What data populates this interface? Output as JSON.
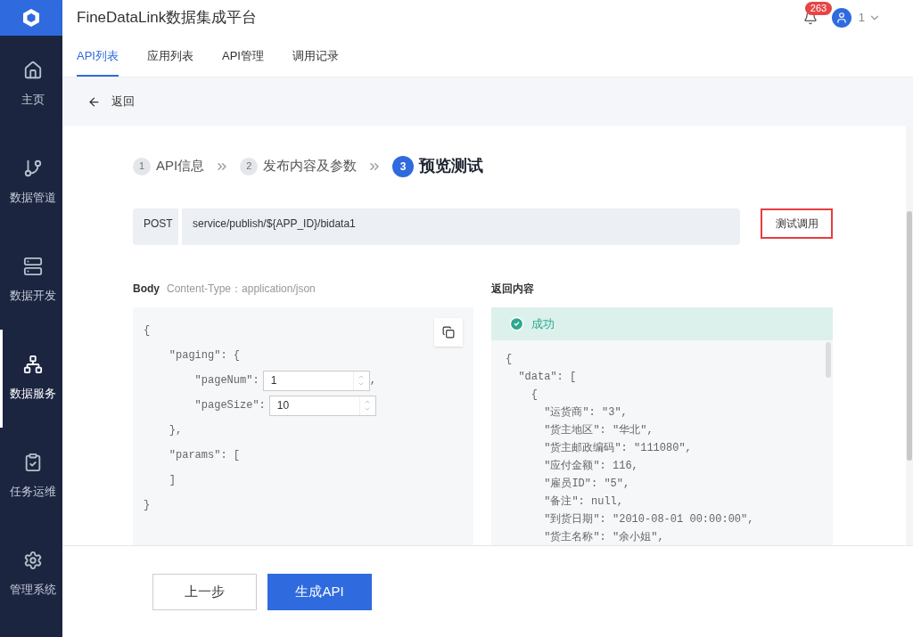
{
  "app": {
    "title": "FineDataLink数据集成平台",
    "notifications": "263",
    "user": "1"
  },
  "sidebar": {
    "items": [
      {
        "label": "主页",
        "selected": false
      },
      {
        "label": "数据管道",
        "selected": false
      },
      {
        "label": "数据开发",
        "selected": false
      },
      {
        "label": "数据服务",
        "selected": true
      },
      {
        "label": "任务运维",
        "selected": false
      },
      {
        "label": "管理系统",
        "selected": false
      }
    ]
  },
  "tabs": [
    {
      "label": "API列表",
      "selected": true
    },
    {
      "label": "应用列表",
      "selected": false
    },
    {
      "label": "API管理",
      "selected": false
    },
    {
      "label": "调用记录",
      "selected": false
    }
  ],
  "back": "返回",
  "steps": [
    {
      "number": "1",
      "label": "API信息",
      "selected": false
    },
    {
      "number": "2",
      "label": "发布内容及参数",
      "selected": false
    },
    {
      "number": "3",
      "label": "预览测试",
      "selected": true
    }
  ],
  "request": {
    "method": "POST",
    "url": "service/publish/${APP_ID}/bidata1",
    "test_button": "测试调用"
  },
  "body": {
    "title": "Body",
    "content_type": "Content-Type：application/json",
    "lines": [
      {
        "kind": "text",
        "text": "{"
      },
      {
        "kind": "text",
        "text": "    \"paging\": {"
      },
      {
        "kind": "input",
        "text": "        \"pageNum\":",
        "value": "1",
        "suffix": ","
      },
      {
        "kind": "input",
        "text": "        \"pageSize\":",
        "value": "10"
      },
      {
        "kind": "text",
        "text": "    },"
      },
      {
        "kind": "text",
        "text": "    \"params\": ["
      },
      {
        "kind": "text",
        "text": "    ]"
      },
      {
        "kind": "text",
        "text": "}"
      }
    ]
  },
  "response": {
    "title": "返回内容",
    "status": "成功",
    "lines": [
      "{",
      "  \"data\": [",
      "    {",
      "      \"运货商\": \"3\",",
      "      \"货主地区\": \"华北\",",
      "      \"货主邮政编码\": \"111080\",",
      "      \"应付金额\": 116,",
      "      \"雇员ID\": \"5\",",
      "      \"备注\": null,",
      "      \"到货日期\": \"2010-08-01 00:00:00\",",
      "      \"货主名称\": \"余小姐\","
    ]
  },
  "footer": {
    "prev": "上一步",
    "generate": "生成API"
  }
}
